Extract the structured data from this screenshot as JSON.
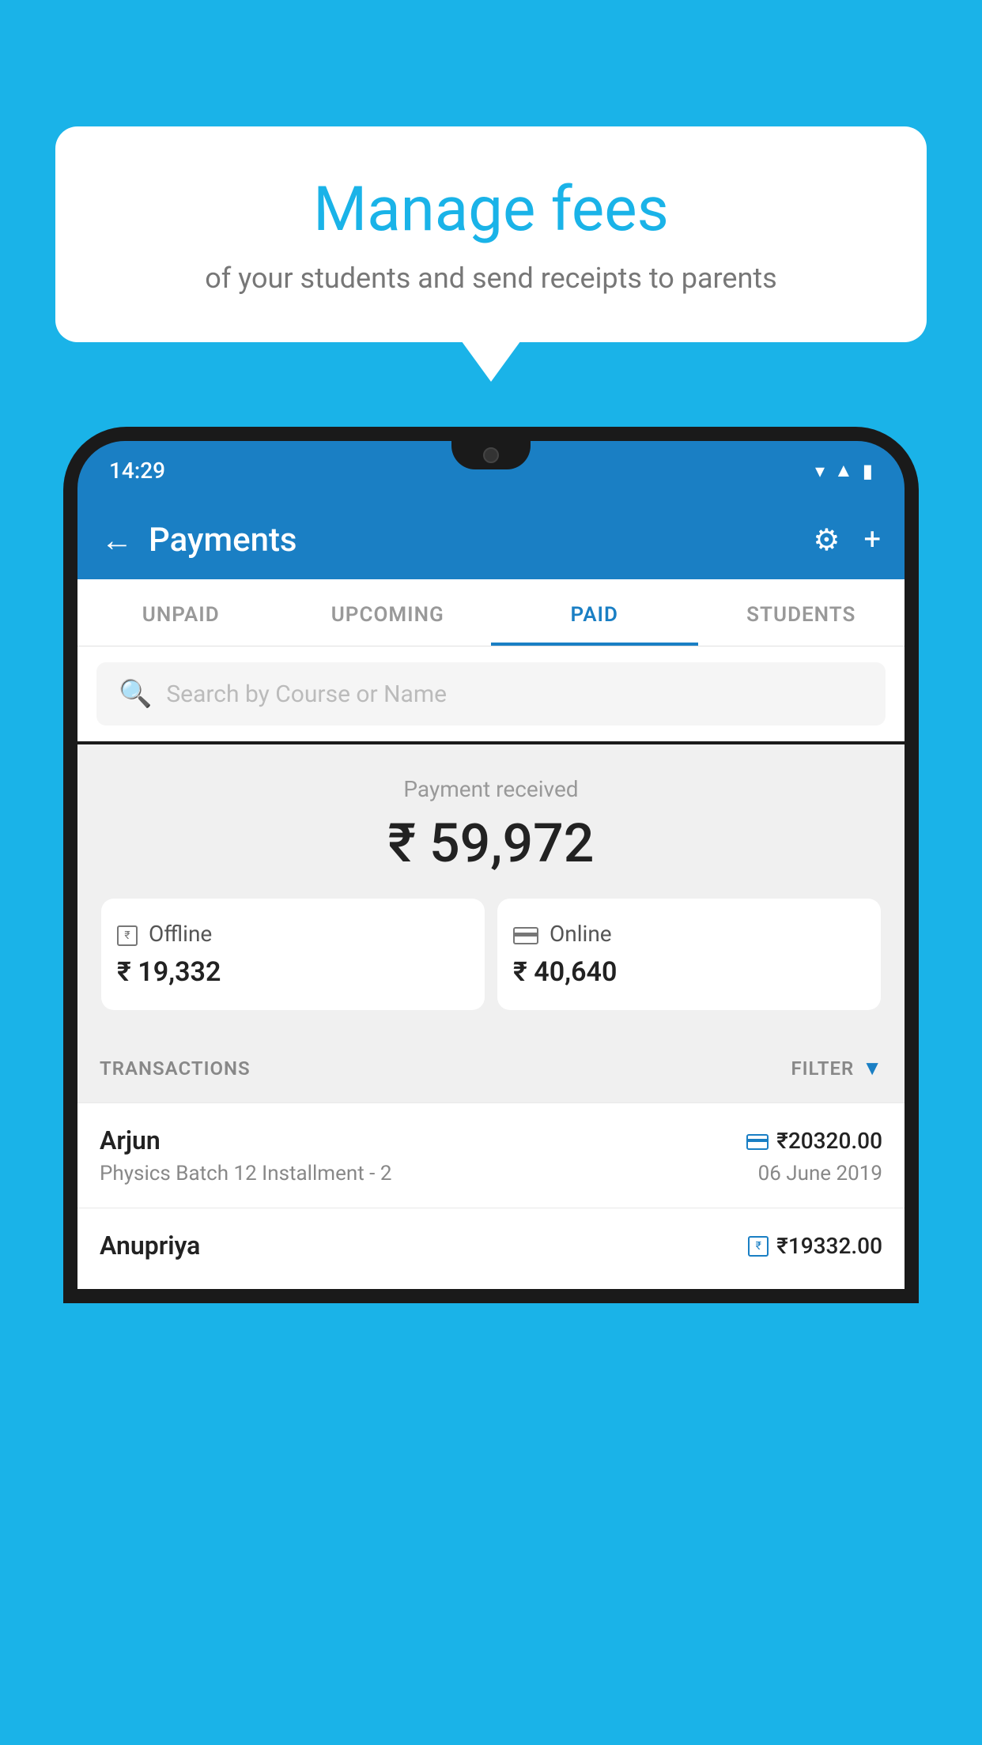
{
  "background_color": "#1ab3e8",
  "bubble": {
    "title": "Manage fees",
    "subtitle": "of your students and send receipts to parents"
  },
  "status_bar": {
    "time": "14:29",
    "wifi_icon": "wifi",
    "signal_icon": "signal",
    "battery_icon": "battery"
  },
  "topbar": {
    "title": "Payments",
    "back_label": "←",
    "gear_label": "⚙",
    "plus_label": "+"
  },
  "tabs": [
    {
      "label": "UNPAID",
      "active": false
    },
    {
      "label": "UPCOMING",
      "active": false
    },
    {
      "label": "PAID",
      "active": true
    },
    {
      "label": "STUDENTS",
      "active": false
    }
  ],
  "search": {
    "placeholder": "Search by Course or Name"
  },
  "payment_summary": {
    "label": "Payment received",
    "amount": "₹ 59,972",
    "offline": {
      "label": "Offline",
      "amount": "₹ 19,332"
    },
    "online": {
      "label": "Online",
      "amount": "₹ 40,640"
    }
  },
  "transactions": {
    "header_label": "TRANSACTIONS",
    "filter_label": "FILTER",
    "rows": [
      {
        "name": "Arjun",
        "amount": "₹20320.00",
        "course": "Physics Batch 12 Installment - 2",
        "date": "06 June 2019",
        "icon_type": "card"
      },
      {
        "name": "Anupriya",
        "amount": "₹19332.00",
        "course": "",
        "date": "",
        "icon_type": "rupee"
      }
    ]
  }
}
